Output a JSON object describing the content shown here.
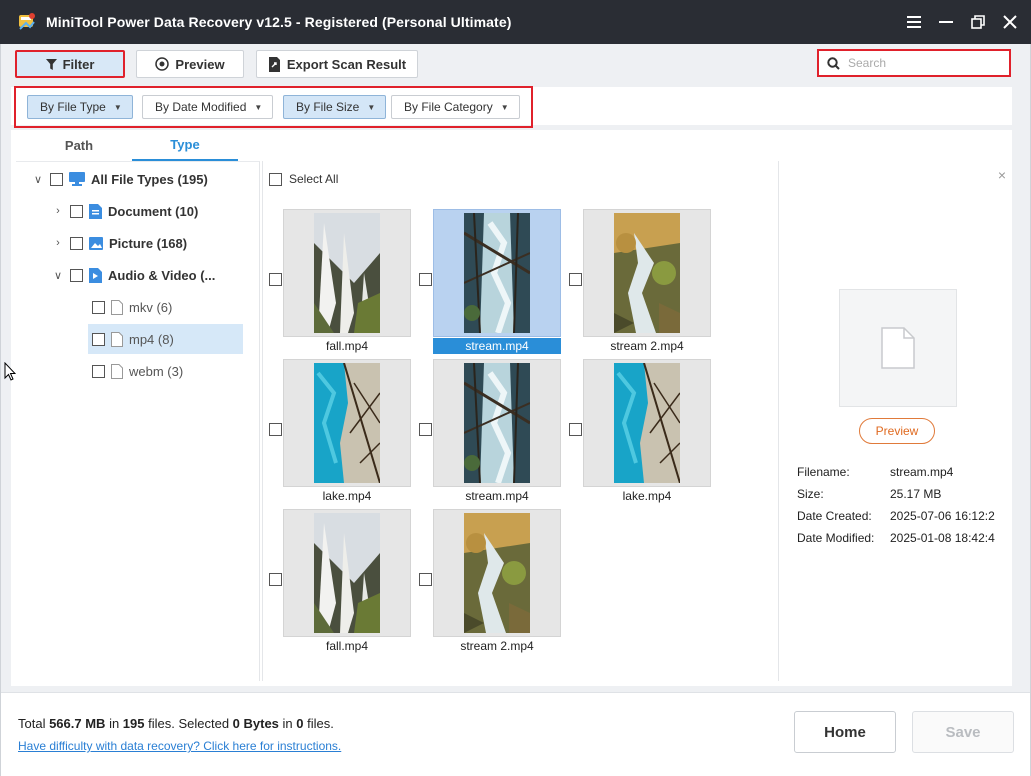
{
  "window": {
    "title": "MiniTool Power Data Recovery v12.5 - Registered (Personal Ultimate)"
  },
  "toolbar": {
    "filter_label": "Filter",
    "preview_label": "Preview",
    "export_label": "Export Scan Result",
    "search_placeholder": "Search"
  },
  "filters": [
    {
      "label": "By File Type",
      "active": true
    },
    {
      "label": "By Date Modified",
      "active": false
    },
    {
      "label": "By File Size",
      "active": true
    },
    {
      "label": "By File Category",
      "active": false
    }
  ],
  "tabs": [
    {
      "label": "Path",
      "active": false
    },
    {
      "label": "Type",
      "active": true
    }
  ],
  "tree": {
    "root": "All File Types (195)",
    "document": "Document (10)",
    "picture": "Picture (168)",
    "audio_video": "Audio & Video (...",
    "mkv": "mkv (6)",
    "mp4": "mp4 (8)",
    "webm": "webm (3)"
  },
  "grid": {
    "select_all": "Select All",
    "files": [
      {
        "name": "fall.mp4",
        "selected": false,
        "scene": "waterfall"
      },
      {
        "name": "stream.mp4",
        "selected": true,
        "scene": "forest-stream"
      },
      {
        "name": "stream 2.mp4",
        "selected": false,
        "scene": "autumn-stream"
      },
      {
        "name": "lake.mp4",
        "selected": false,
        "scene": "turquoise-lake"
      },
      {
        "name": "stream.mp4",
        "selected": false,
        "scene": "forest-stream"
      },
      {
        "name": "lake.mp4",
        "selected": false,
        "scene": "turquoise-lake"
      },
      {
        "name": "fall.mp4",
        "selected": false,
        "scene": "waterfall"
      },
      {
        "name": "stream 2.mp4",
        "selected": false,
        "scene": "autumn-stream"
      }
    ]
  },
  "details": {
    "preview_label": "Preview",
    "filename_label": "Filename:",
    "filename": "stream.mp4",
    "size_label": "Size:",
    "size": "25.17 MB",
    "created_label": "Date Created:",
    "created": "2025-07-06 16:12:2",
    "modified_label": "Date Modified:",
    "modified": "2025-01-08 18:42:4"
  },
  "footer": {
    "total_prefix": "Total ",
    "total_size": "566.7 MB",
    "in1": " in ",
    "total_files": "195",
    "files_sel": " files.  Selected ",
    "selected_size": "0 Bytes",
    "in2": " in ",
    "selected_files": "0",
    "files_end": " files.",
    "help_link": "Have difficulty with data recovery? Click here for instructions.",
    "home_label": "Home",
    "save_label": "Save"
  },
  "colors": {
    "accent": "#2a8ed8",
    "highlight_red": "#e0212b",
    "title_bg": "#2a2d34",
    "preview_orange": "#e06a20"
  }
}
